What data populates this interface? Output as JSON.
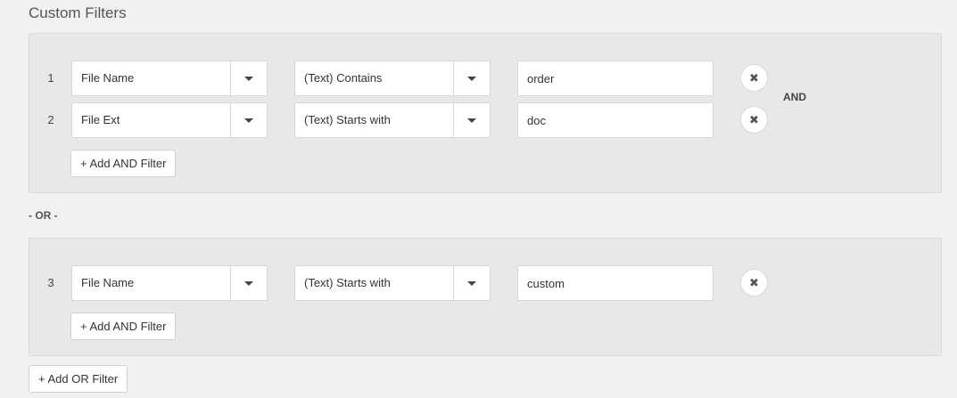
{
  "section": {
    "title": "Custom Filters"
  },
  "groups": [
    {
      "rows": [
        {
          "num": "1",
          "field": "File Name",
          "operator": "(Text) Contains",
          "value": "order"
        },
        {
          "num": "2",
          "field": "File Ext",
          "operator": "(Text) Starts with",
          "value": "doc"
        }
      ],
      "join_label": "AND",
      "add_and_label": "+ Add AND Filter"
    },
    {
      "rows": [
        {
          "num": "3",
          "field": "File Name",
          "operator": "(Text) Starts with",
          "value": "custom"
        }
      ],
      "add_and_label": "+ Add AND Filter"
    }
  ],
  "or_separator": "- OR -",
  "add_or_label": "+ Add OR Filter",
  "icons": {
    "dropdown": "caret-down-icon",
    "remove": "close-icon"
  },
  "colors": {
    "background": "#f1f1f1",
    "group_background": "#e8e8e8",
    "border": "#d7d7d7"
  }
}
